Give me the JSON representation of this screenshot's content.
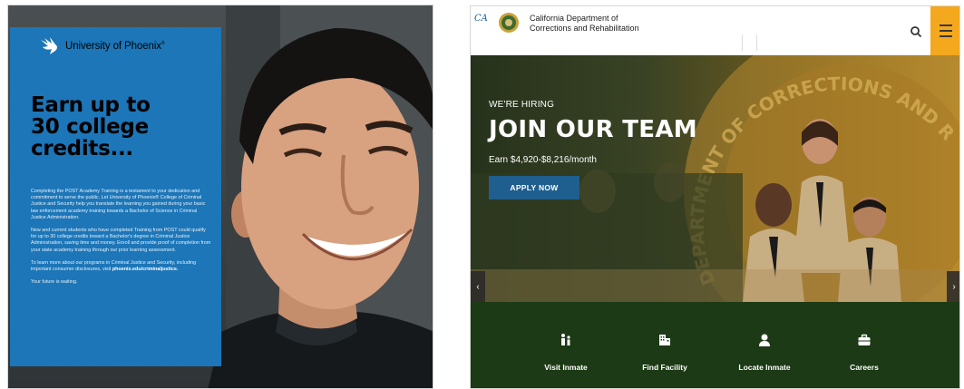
{
  "ad": {
    "brand": "University of Phoenix",
    "brand_mark": "®",
    "headline": [
      "Earn up to",
      "30 college",
      "credits..."
    ],
    "paragraph_1": "Completing the POST Academy Training is a testament to your dedication and commitment to serve the public. Let University of Phoenix® College of Criminal Justice and Security help you translate the learning you gained during your basic law enforcement academy training towards a Bachelor of Science in Criminal Justice Administration.",
    "paragraph_2": "New and current students who have completed Training from POST could qualify for up to 30 college credits toward a Bachelor's degree in Criminal Justice Administration, saving time and money.  Enroll and provide proof of completion from your state academy training through our prior learning assessment.",
    "paragraph_3_lead": "To learn more about our programs in Criminal Justice and Security, including important consumer disclosures, visit",
    "paragraph_3_link": "phoenix.edu/criminaljustice.",
    "closing": "Your future is waiting."
  },
  "site": {
    "ca_logo_text": "CA",
    "agency_line_1": "California Department of",
    "agency_line_2": "Corrections and Rehabilitation",
    "hero": {
      "kicker": "WE'RE HIRING",
      "title": "JOIN OUR TEAM",
      "pay": "Earn $4,920-$8,216/month",
      "cta": "APPLY NOW",
      "seal_text": "DEPARTMENT OF CORRECTIONS AND REHABILITATION"
    },
    "quick_links": [
      {
        "label": "Visit Inmate",
        "icon": "visit-people-icon"
      },
      {
        "label": "Find Facility",
        "icon": "building-icon"
      },
      {
        "label": "Locate Inmate",
        "icon": "person-icon"
      },
      {
        "label": "Careers",
        "icon": "briefcase-icon"
      }
    ],
    "prev_arrow": "‹",
    "next_arrow": "›"
  },
  "colors": {
    "ad_blue": "#1c76b8",
    "cta_blue": "#1f5f8f",
    "menu_gold": "#f4a81d",
    "quick_green": "#1c3a15"
  }
}
